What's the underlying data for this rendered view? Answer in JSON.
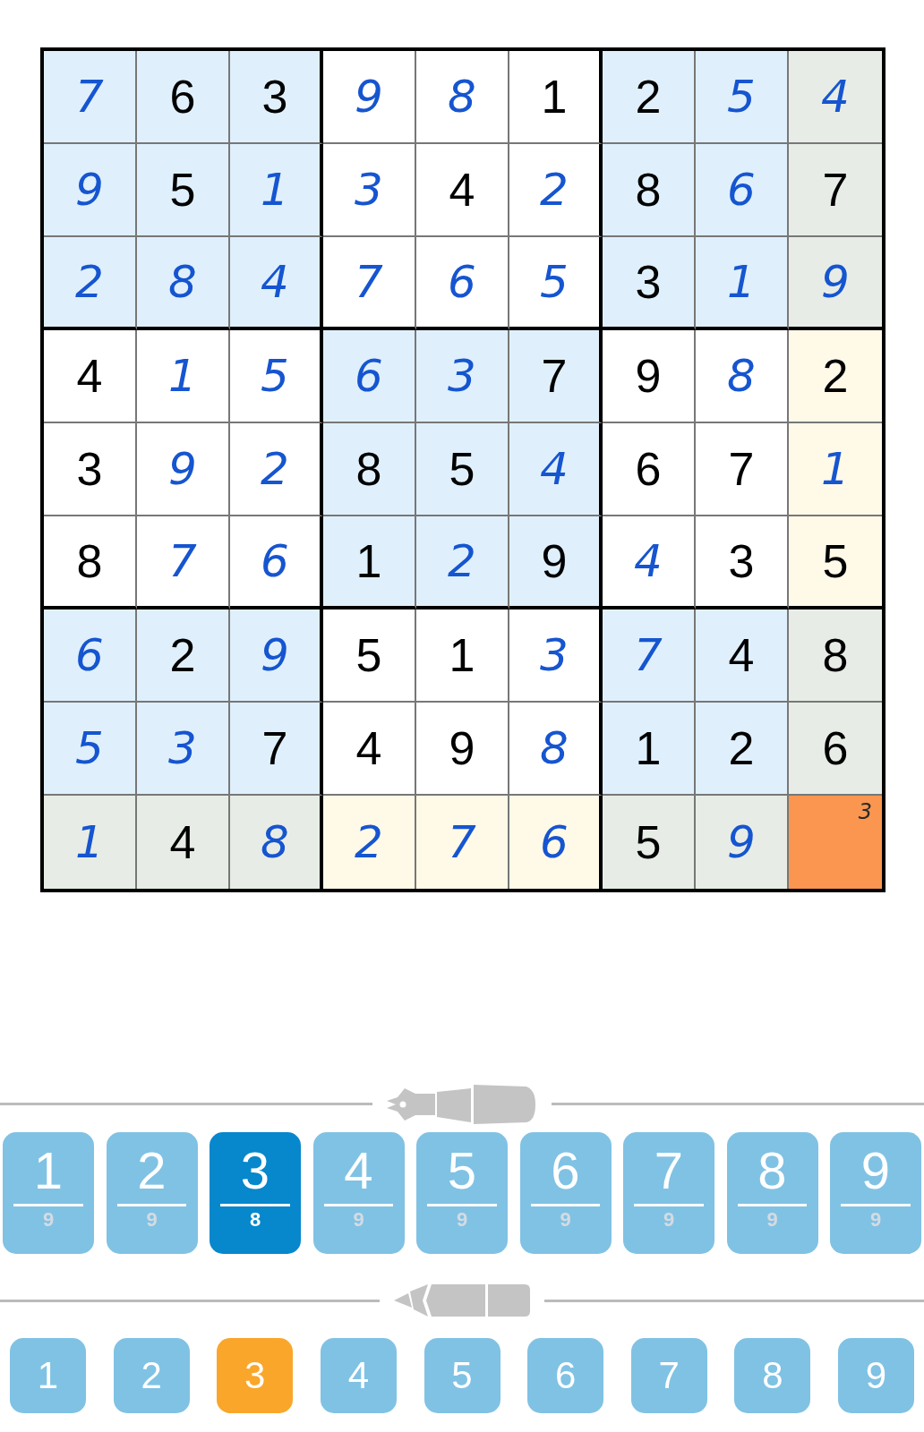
{
  "grid": {
    "rows": [
      [
        {
          "value": "7",
          "kind": "entered",
          "color": "#dff0fc",
          "selected": false
        },
        {
          "value": "6",
          "kind": "given",
          "color": "#dff0fc",
          "selected": false
        },
        {
          "value": "3",
          "kind": "given",
          "color": "#dff0fc",
          "selected": false
        },
        {
          "value": "9",
          "kind": "entered",
          "color": "#ffffff",
          "selected": false
        },
        {
          "value": "8",
          "kind": "entered",
          "color": "#ffffff",
          "selected": false
        },
        {
          "value": "1",
          "kind": "given",
          "color": "#ffffff",
          "selected": false
        },
        {
          "value": "2",
          "kind": "given",
          "color": "#dff0fc",
          "selected": false
        },
        {
          "value": "5",
          "kind": "entered",
          "color": "#dff0fc",
          "selected": false
        },
        {
          "value": "4",
          "kind": "entered",
          "color": "#e7ede6",
          "selected": false
        }
      ],
      [
        {
          "value": "9",
          "kind": "entered",
          "color": "#dff0fc",
          "selected": false
        },
        {
          "value": "5",
          "kind": "given",
          "color": "#dff0fc",
          "selected": false
        },
        {
          "value": "1",
          "kind": "entered",
          "color": "#dff0fc",
          "selected": false
        },
        {
          "value": "3",
          "kind": "entered",
          "color": "#ffffff",
          "selected": false
        },
        {
          "value": "4",
          "kind": "given",
          "color": "#ffffff",
          "selected": false
        },
        {
          "value": "2",
          "kind": "entered",
          "color": "#ffffff",
          "selected": false
        },
        {
          "value": "8",
          "kind": "given",
          "color": "#dff0fc",
          "selected": false
        },
        {
          "value": "6",
          "kind": "entered",
          "color": "#dff0fc",
          "selected": false
        },
        {
          "value": "7",
          "kind": "given",
          "color": "#e7ede6",
          "selected": false
        }
      ],
      [
        {
          "value": "2",
          "kind": "entered",
          "color": "#dff0fc",
          "selected": false
        },
        {
          "value": "8",
          "kind": "entered",
          "color": "#dff0fc",
          "selected": false
        },
        {
          "value": "4",
          "kind": "entered",
          "color": "#dff0fc",
          "selected": false
        },
        {
          "value": "7",
          "kind": "entered",
          "color": "#ffffff",
          "selected": false
        },
        {
          "value": "6",
          "kind": "entered",
          "color": "#ffffff",
          "selected": false
        },
        {
          "value": "5",
          "kind": "entered",
          "color": "#ffffff",
          "selected": false
        },
        {
          "value": "3",
          "kind": "given",
          "color": "#dff0fc",
          "selected": false
        },
        {
          "value": "1",
          "kind": "entered",
          "color": "#dff0fc",
          "selected": false
        },
        {
          "value": "9",
          "kind": "entered",
          "color": "#e7ede6",
          "selected": false
        }
      ],
      [
        {
          "value": "4",
          "kind": "given",
          "color": "#ffffff",
          "selected": false
        },
        {
          "value": "1",
          "kind": "entered",
          "color": "#ffffff",
          "selected": false
        },
        {
          "value": "5",
          "kind": "entered",
          "color": "#ffffff",
          "selected": false
        },
        {
          "value": "6",
          "kind": "entered",
          "color": "#dff0fc",
          "selected": false
        },
        {
          "value": "3",
          "kind": "entered",
          "color": "#dff0fc",
          "selected": false
        },
        {
          "value": "7",
          "kind": "given",
          "color": "#dff0fc",
          "selected": false
        },
        {
          "value": "9",
          "kind": "given",
          "color": "#ffffff",
          "selected": false
        },
        {
          "value": "8",
          "kind": "entered",
          "color": "#ffffff",
          "selected": false
        },
        {
          "value": "2",
          "kind": "given",
          "color": "#fff9e8",
          "selected": false
        }
      ],
      [
        {
          "value": "3",
          "kind": "given",
          "color": "#ffffff",
          "selected": false
        },
        {
          "value": "9",
          "kind": "entered",
          "color": "#ffffff",
          "selected": false
        },
        {
          "value": "2",
          "kind": "entered",
          "color": "#ffffff",
          "selected": false
        },
        {
          "value": "8",
          "kind": "given",
          "color": "#dff0fc",
          "selected": false
        },
        {
          "value": "5",
          "kind": "given",
          "color": "#dff0fc",
          "selected": false
        },
        {
          "value": "4",
          "kind": "entered",
          "color": "#dff0fc",
          "selected": false
        },
        {
          "value": "6",
          "kind": "given",
          "color": "#ffffff",
          "selected": false
        },
        {
          "value": "7",
          "kind": "given",
          "color": "#ffffff",
          "selected": false
        },
        {
          "value": "1",
          "kind": "entered",
          "color": "#fff9e8",
          "selected": false
        }
      ],
      [
        {
          "value": "8",
          "kind": "given",
          "color": "#ffffff",
          "selected": false
        },
        {
          "value": "7",
          "kind": "entered",
          "color": "#ffffff",
          "selected": false
        },
        {
          "value": "6",
          "kind": "entered",
          "color": "#ffffff",
          "selected": false
        },
        {
          "value": "1",
          "kind": "given",
          "color": "#dff0fc",
          "selected": false
        },
        {
          "value": "2",
          "kind": "entered",
          "color": "#dff0fc",
          "selected": false
        },
        {
          "value": "9",
          "kind": "given",
          "color": "#dff0fc",
          "selected": false
        },
        {
          "value": "4",
          "kind": "entered",
          "color": "#ffffff",
          "selected": false
        },
        {
          "value": "3",
          "kind": "given",
          "color": "#ffffff",
          "selected": false
        },
        {
          "value": "5",
          "kind": "given",
          "color": "#fff9e8",
          "selected": false
        }
      ],
      [
        {
          "value": "6",
          "kind": "entered",
          "color": "#dff0fc",
          "selected": false
        },
        {
          "value": "2",
          "kind": "given",
          "color": "#dff0fc",
          "selected": false
        },
        {
          "value": "9",
          "kind": "entered",
          "color": "#dff0fc",
          "selected": false
        },
        {
          "value": "5",
          "kind": "given",
          "color": "#ffffff",
          "selected": false
        },
        {
          "value": "1",
          "kind": "given",
          "color": "#ffffff",
          "selected": false
        },
        {
          "value": "3",
          "kind": "entered",
          "color": "#ffffff",
          "selected": false
        },
        {
          "value": "7",
          "kind": "entered",
          "color": "#dff0fc",
          "selected": false
        },
        {
          "value": "4",
          "kind": "given",
          "color": "#dff0fc",
          "selected": false
        },
        {
          "value": "8",
          "kind": "given",
          "color": "#e7ede6",
          "selected": false
        }
      ],
      [
        {
          "value": "5",
          "kind": "entered",
          "color": "#dff0fc",
          "selected": false
        },
        {
          "value": "3",
          "kind": "entered",
          "color": "#dff0fc",
          "selected": false
        },
        {
          "value": "7",
          "kind": "given",
          "color": "#dff0fc",
          "selected": false
        },
        {
          "value": "4",
          "kind": "given",
          "color": "#ffffff",
          "selected": false
        },
        {
          "value": "9",
          "kind": "given",
          "color": "#ffffff",
          "selected": false
        },
        {
          "value": "8",
          "kind": "entered",
          "color": "#ffffff",
          "selected": false
        },
        {
          "value": "1",
          "kind": "given",
          "color": "#dff0fc",
          "selected": false
        },
        {
          "value": "2",
          "kind": "given",
          "color": "#dff0fc",
          "selected": false
        },
        {
          "value": "6",
          "kind": "given",
          "color": "#e7ede6",
          "selected": false
        }
      ],
      [
        {
          "value": "1",
          "kind": "entered",
          "color": "#e7ede6",
          "selected": false
        },
        {
          "value": "4",
          "kind": "given",
          "color": "#e7ede6",
          "selected": false
        },
        {
          "value": "8",
          "kind": "entered",
          "color": "#e7ede6",
          "selected": false
        },
        {
          "value": "2",
          "kind": "entered",
          "color": "#fff9e8",
          "selected": false
        },
        {
          "value": "7",
          "kind": "entered",
          "color": "#fff9e8",
          "selected": false
        },
        {
          "value": "6",
          "kind": "entered",
          "color": "#fff9e8",
          "selected": false
        },
        {
          "value": "5",
          "kind": "given",
          "color": "#e7ede6",
          "selected": false
        },
        {
          "value": "9",
          "kind": "entered",
          "color": "#e7ede6",
          "selected": false
        },
        {
          "kind": "empty",
          "notes": [
            "3"
          ],
          "selected": true
        }
      ]
    ]
  },
  "pen_keypad": {
    "keys": [
      {
        "digit": "1",
        "count": "9",
        "selected": false
      },
      {
        "digit": "2",
        "count": "9",
        "selected": false
      },
      {
        "digit": "3",
        "count": "8",
        "selected": true
      },
      {
        "digit": "4",
        "count": "9",
        "selected": false
      },
      {
        "digit": "5",
        "count": "9",
        "selected": false
      },
      {
        "digit": "6",
        "count": "9",
        "selected": false
      },
      {
        "digit": "7",
        "count": "9",
        "selected": false
      },
      {
        "digit": "8",
        "count": "9",
        "selected": false
      },
      {
        "digit": "9",
        "count": "9",
        "selected": false
      }
    ]
  },
  "pencil_keypad": {
    "keys": [
      {
        "digit": "1",
        "selected": false
      },
      {
        "digit": "2",
        "selected": false
      },
      {
        "digit": "3",
        "selected": true
      },
      {
        "digit": "4",
        "selected": false
      },
      {
        "digit": "5",
        "selected": false
      },
      {
        "digit": "6",
        "selected": false
      },
      {
        "digit": "7",
        "selected": false
      },
      {
        "digit": "8",
        "selected": false
      },
      {
        "digit": "9",
        "selected": false
      }
    ]
  }
}
